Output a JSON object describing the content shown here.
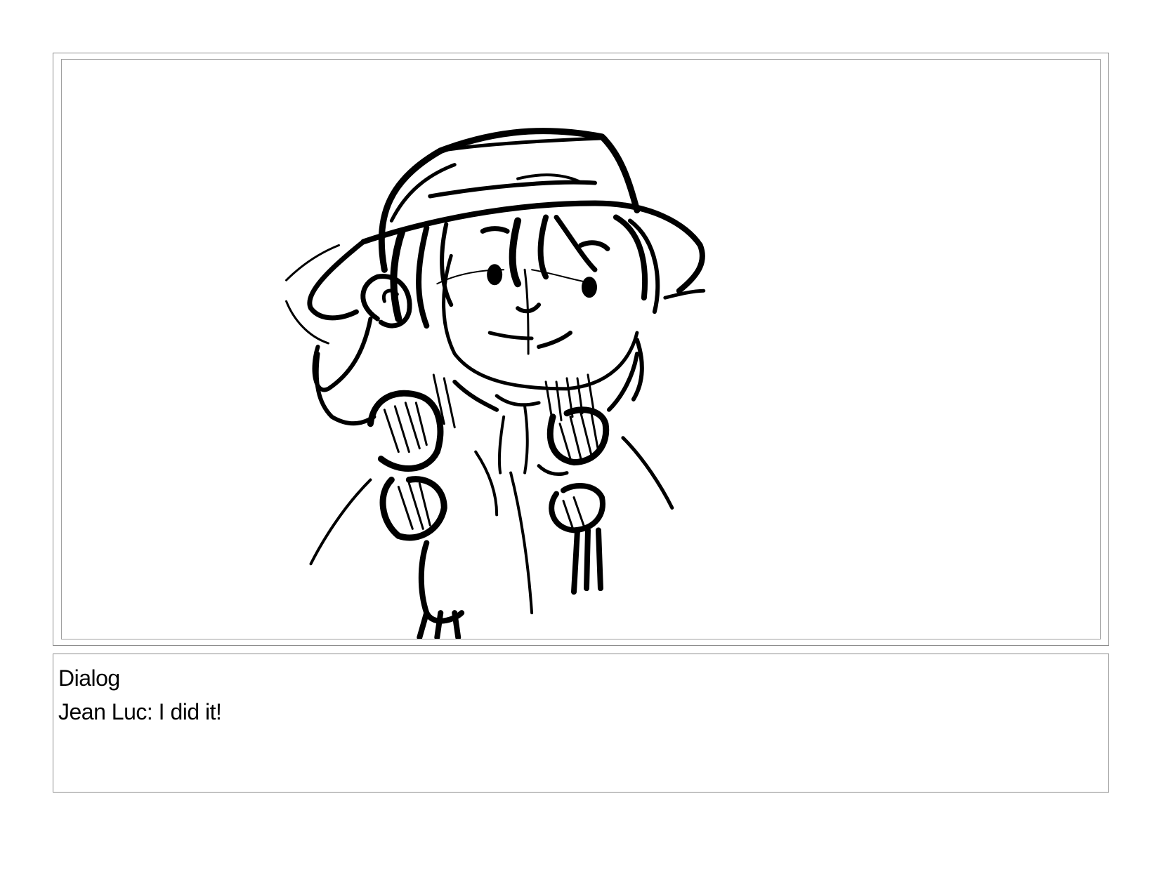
{
  "storyboard": {
    "panel": {
      "image": "sketch of a smiling girl in a bucket hat with braided pigtails"
    },
    "dialog": {
      "heading": "Dialog",
      "line": "Jean Luc: I did it!"
    }
  }
}
